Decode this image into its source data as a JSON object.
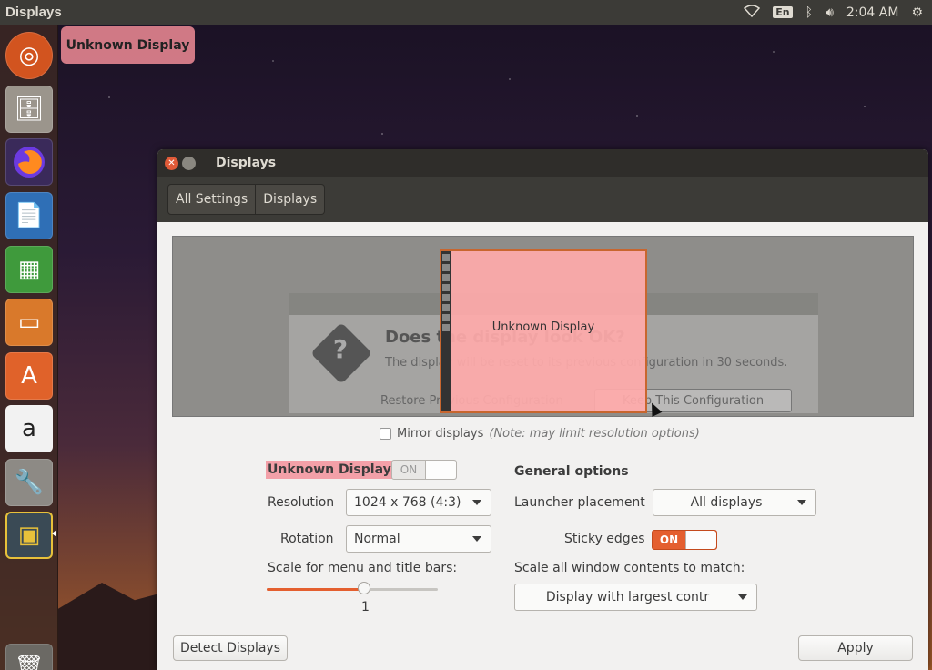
{
  "top_panel": {
    "app_title": "Displays",
    "keyboard_layout": "En",
    "clock": "2:04 AM"
  },
  "launcher": {
    "items": [
      "ubuntu-dash",
      "files",
      "firefox",
      "libreoffice-writer",
      "libreoffice-calc",
      "libreoffice-impress",
      "ubuntu-software",
      "amazon",
      "system-settings",
      "displays",
      "trash"
    ]
  },
  "tooltip": {
    "text": "Unknown Display"
  },
  "window": {
    "title": "Displays",
    "breadcrumbs": [
      "All Settings",
      "Displays"
    ]
  },
  "arrangement": {
    "monitor_label": "Unknown Display",
    "confirm_dialog": {
      "heading": "Does the display look OK?",
      "message": "The display will be reset to its previous configuration in 30 seconds.",
      "restore_button": "Restore Previous Configuration",
      "keep_button": "Keep This Configuration"
    }
  },
  "mirror": {
    "label": "Mirror displays",
    "note": "(Note: may limit resolution options)",
    "checked": false
  },
  "display_settings": {
    "display_name": "Unknown Display",
    "display_toggle": "ON",
    "display_enabled": false,
    "resolution_label": "Resolution",
    "resolution_value": "1024 x 768 (4:3)",
    "rotation_label": "Rotation",
    "rotation_value": "Normal",
    "scale_label": "Scale for menu and title bars:",
    "scale_value": "1",
    "scale_fraction": 0.57
  },
  "general_options": {
    "heading": "General options",
    "launcher_placement_label": "Launcher placement",
    "launcher_placement_value": "All displays",
    "sticky_edges_label": "Sticky edges",
    "sticky_edges_toggle": "ON",
    "sticky_edges_enabled": true,
    "scale_all_label": "Scale all window contents to match:",
    "scale_all_value": "Display with largest contr"
  },
  "footer": {
    "detect_button": "Detect Displays",
    "apply_button": "Apply"
  },
  "colors": {
    "accent": "#e45f2f",
    "highlight": "#f3a0a8",
    "panel": "#3c3b37"
  }
}
